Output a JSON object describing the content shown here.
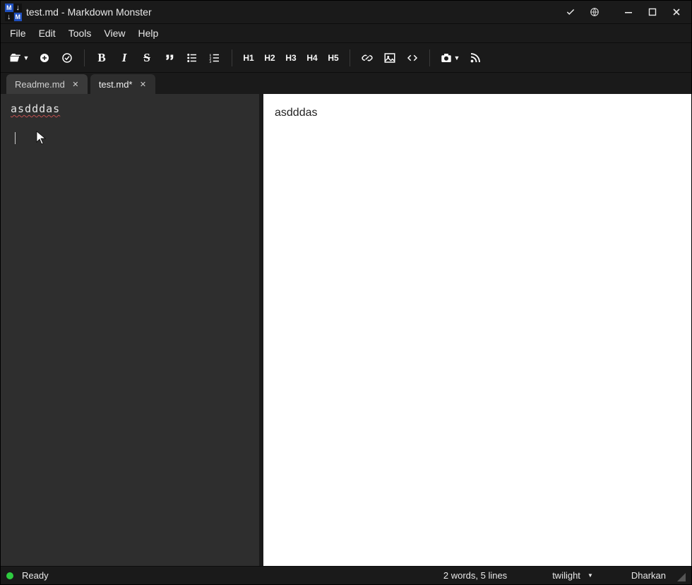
{
  "title": {
    "file": "test.md",
    "sep": " - ",
    "app": "Markdown Monster"
  },
  "menu": {
    "file": "File",
    "edit": "Edit",
    "tools": "Tools",
    "view": "View",
    "help": "Help"
  },
  "toolbar": {
    "h1": "H1",
    "h2": "H2",
    "h3": "H3",
    "h4": "H4",
    "h5": "H5"
  },
  "tabs": [
    {
      "label": "Readme.md",
      "active": false
    },
    {
      "label": "test.md*",
      "active": true
    }
  ],
  "editor": {
    "content": "asdddas"
  },
  "preview": {
    "content": "asdddas"
  },
  "status": {
    "ready": "Ready",
    "stats": "2 words, 5 lines",
    "theme": "twilight",
    "preview_theme": "Dharkan"
  },
  "colors": {
    "chrome": "#1a1a1a",
    "editor_bg": "#2e2e2e",
    "preview_bg": "#ffffff",
    "accent_green": "#2ecc40"
  }
}
